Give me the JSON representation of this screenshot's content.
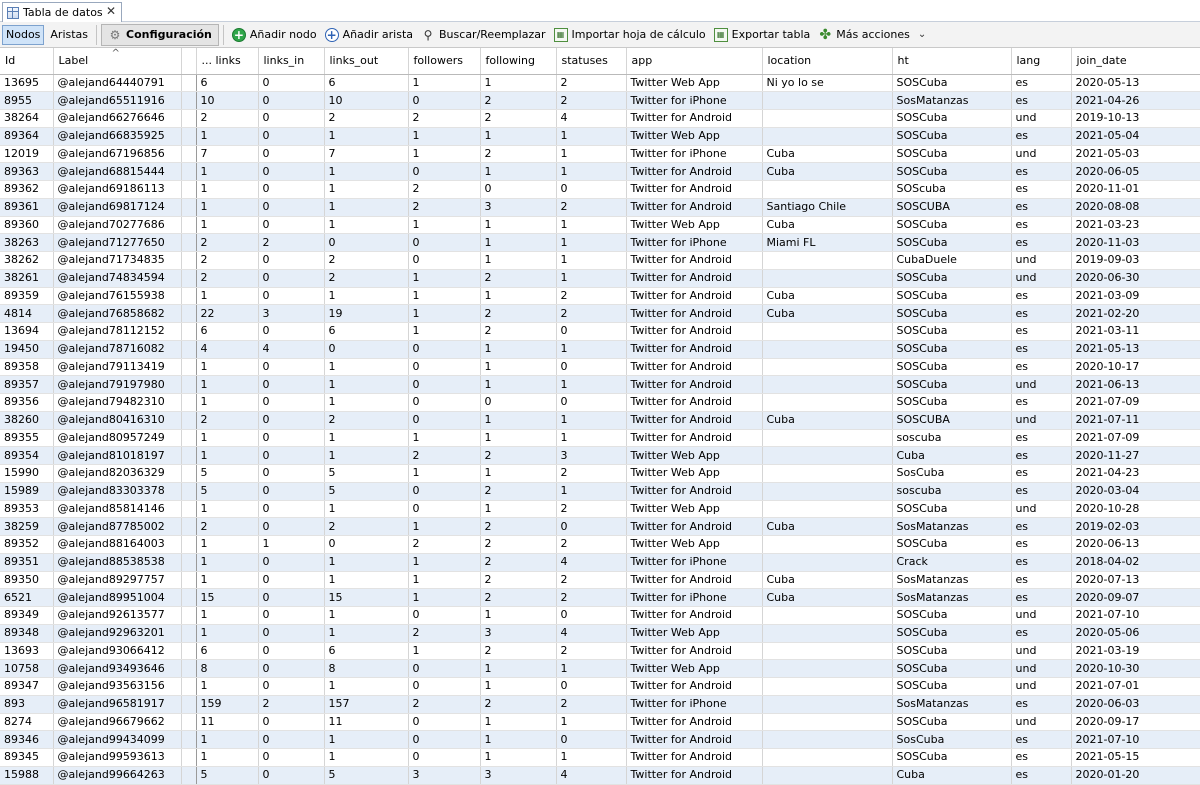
{
  "tab": {
    "title": "Tabla de datos",
    "close": "✕"
  },
  "toolbar": {
    "nodes": "Nodos",
    "edges": "Aristas",
    "config": "Configuración",
    "add_node": "Añadir nodo",
    "add_edge": "Añadir arista",
    "search_replace": "Buscar/Reemplazar",
    "import_sheet": "Importar hoja de cálculo",
    "export_table": "Exportar tabla",
    "more_actions": "Más acciones"
  },
  "table": {
    "columns": [
      "Id",
      "Label",
      "",
      "... links",
      "links_in",
      "links_out",
      "followers",
      "following",
      "statuses",
      "app",
      "location",
      "ht",
      "lang",
      "join_date"
    ],
    "rows": [
      [
        "13695",
        "@alejand64440791",
        "",
        "6",
        "0",
        "6",
        "1",
        "1",
        "2",
        "Twitter Web App",
        "Ni yo lo se",
        "SOSCuba",
        "es",
        "2020-05-13"
      ],
      [
        "8955",
        "@alejand65511916",
        "",
        "10",
        "0",
        "10",
        "0",
        "2",
        "2",
        "Twitter for iPhone",
        "",
        "SosMatanzas",
        "es",
        "2021-04-26"
      ],
      [
        "38264",
        "@alejand66276646",
        "",
        "2",
        "0",
        "2",
        "2",
        "2",
        "4",
        "Twitter for Android",
        "",
        "SOSCuba",
        "und",
        "2019-10-13"
      ],
      [
        "89364",
        "@alejand66835925",
        "",
        "1",
        "0",
        "1",
        "1",
        "1",
        "1",
        "Twitter Web App",
        "",
        "SOSCuba",
        "es",
        "2021-05-04"
      ],
      [
        "12019",
        "@alejand67196856",
        "",
        "7",
        "0",
        "7",
        "1",
        "2",
        "1",
        "Twitter for iPhone",
        "Cuba",
        "SOSCuba",
        "und",
        "2021-05-03"
      ],
      [
        "89363",
        "@alejand68815444",
        "",
        "1",
        "0",
        "1",
        "0",
        "1",
        "1",
        "Twitter for Android",
        "Cuba",
        "SOSCuba",
        "es",
        "2020-06-05"
      ],
      [
        "89362",
        "@alejand69186113",
        "",
        "1",
        "0",
        "1",
        "2",
        "0",
        "0",
        "Twitter for Android",
        "",
        "SOScuba",
        "es",
        "2020-11-01"
      ],
      [
        "89361",
        "@alejand69817124",
        "",
        "1",
        "0",
        "1",
        "2",
        "3",
        "2",
        "Twitter for Android",
        "Santiago  Chile",
        "SOSCUBA",
        "es",
        "2020-08-08"
      ],
      [
        "89360",
        "@alejand70277686",
        "",
        "1",
        "0",
        "1",
        "1",
        "1",
        "1",
        "Twitter Web App",
        "Cuba",
        "SOSCuba",
        "es",
        "2021-03-23"
      ],
      [
        "38263",
        "@alejand71277650",
        "",
        "2",
        "2",
        "0",
        "0",
        "1",
        "1",
        "Twitter for iPhone",
        "Miami  FL",
        "SOSCuba",
        "es",
        "2020-11-03"
      ],
      [
        "38262",
        "@alejand71734835",
        "",
        "2",
        "0",
        "2",
        "0",
        "1",
        "1",
        "Twitter for Android",
        "",
        "CubaDuele",
        "und",
        "2019-09-03"
      ],
      [
        "38261",
        "@alejand74834594",
        "",
        "2",
        "0",
        "2",
        "1",
        "2",
        "1",
        "Twitter for Android",
        "",
        "SOSCuba",
        "und",
        "2020-06-30"
      ],
      [
        "89359",
        "@alejand76155938",
        "",
        "1",
        "0",
        "1",
        "1",
        "1",
        "2",
        "Twitter for Android",
        "Cuba",
        "SOSCuba",
        "es",
        "2021-03-09"
      ],
      [
        "4814",
        "@alejand76858682",
        "",
        "22",
        "3",
        "19",
        "1",
        "2",
        "2",
        "Twitter for Android",
        "Cuba",
        "SOSCuba",
        "es",
        "2021-02-20"
      ],
      [
        "13694",
        "@alejand78112152",
        "",
        "6",
        "0",
        "6",
        "1",
        "2",
        "0",
        "Twitter for Android",
        "",
        "SOSCuba",
        "es",
        "2021-03-11"
      ],
      [
        "19450",
        "@alejand78716082",
        "",
        "4",
        "4",
        "0",
        "0",
        "1",
        "1",
        "Twitter for Android",
        "",
        "SOSCuba",
        "es",
        "2021-05-13"
      ],
      [
        "89358",
        "@alejand79113419",
        "",
        "1",
        "0",
        "1",
        "0",
        "1",
        "0",
        "Twitter for Android",
        "",
        "SOSCuba",
        "es",
        "2020-10-17"
      ],
      [
        "89357",
        "@alejand79197980",
        "",
        "1",
        "0",
        "1",
        "0",
        "1",
        "1",
        "Twitter for Android",
        "",
        "SOSCuba",
        "und",
        "2021-06-13"
      ],
      [
        "89356",
        "@alejand79482310",
        "",
        "1",
        "0",
        "1",
        "0",
        "0",
        "0",
        "Twitter for Android",
        "",
        "SOSCuba",
        "es",
        "2021-07-09"
      ],
      [
        "38260",
        "@alejand80416310",
        "",
        "2",
        "0",
        "2",
        "0",
        "1",
        "1",
        "Twitter for Android",
        "Cuba",
        "SOSCUBA",
        "und",
        "2021-07-11"
      ],
      [
        "89355",
        "@alejand80957249",
        "",
        "1",
        "0",
        "1",
        "1",
        "1",
        "1",
        "Twitter for Android",
        "",
        "soscuba",
        "es",
        "2021-07-09"
      ],
      [
        "89354",
        "@alejand81018197",
        "",
        "1",
        "0",
        "1",
        "2",
        "2",
        "3",
        "Twitter Web App",
        "",
        "Cuba",
        "es",
        "2020-11-27"
      ],
      [
        "15990",
        "@alejand82036329",
        "",
        "5",
        "0",
        "5",
        "1",
        "1",
        "2",
        "Twitter Web App",
        "",
        "SosCuba",
        "es",
        "2021-04-23"
      ],
      [
        "15989",
        "@alejand83303378",
        "",
        "5",
        "0",
        "5",
        "0",
        "2",
        "1",
        "Twitter for Android",
        "",
        "soscuba",
        "es",
        "2020-03-04"
      ],
      [
        "89353",
        "@alejand85814146",
        "",
        "1",
        "0",
        "1",
        "0",
        "1",
        "2",
        "Twitter Web App",
        "",
        "SOSCuba",
        "und",
        "2020-10-28"
      ],
      [
        "38259",
        "@alejand87785002",
        "",
        "2",
        "0",
        "2",
        "1",
        "2",
        "0",
        "Twitter for Android",
        "Cuba",
        "SosMatanzas",
        "es",
        "2019-02-03"
      ],
      [
        "89352",
        "@alejand88164003",
        "",
        "1",
        "1",
        "0",
        "2",
        "2",
        "2",
        "Twitter Web App",
        "",
        "SOSCuba",
        "es",
        "2020-06-13"
      ],
      [
        "89351",
        "@alejand88538538",
        "",
        "1",
        "0",
        "1",
        "1",
        "2",
        "4",
        "Twitter for iPhone",
        "",
        "Crack",
        "es",
        "2018-04-02"
      ],
      [
        "89350",
        "@alejand89297757",
        "",
        "1",
        "0",
        "1",
        "1",
        "2",
        "2",
        "Twitter for Android",
        "Cuba",
        "SosMatanzas",
        "es",
        "2020-07-13"
      ],
      [
        "6521",
        "@alejand89951004",
        "",
        "15",
        "0",
        "15",
        "1",
        "2",
        "2",
        "Twitter for iPhone",
        "Cuba",
        "SosMatanzas",
        "es",
        "2020-09-07"
      ],
      [
        "89349",
        "@alejand92613577",
        "",
        "1",
        "0",
        "1",
        "0",
        "1",
        "0",
        "Twitter for Android",
        "",
        "SOSCuba",
        "und",
        "2021-07-10"
      ],
      [
        "89348",
        "@alejand92963201",
        "",
        "1",
        "0",
        "1",
        "2",
        "3",
        "4",
        "Twitter Web App",
        "",
        "SOSCuba",
        "es",
        "2020-05-06"
      ],
      [
        "13693",
        "@alejand93066412",
        "",
        "6",
        "0",
        "6",
        "1",
        "2",
        "2",
        "Twitter for Android",
        "",
        "SOSCuba",
        "und",
        "2021-03-19"
      ],
      [
        "10758",
        "@alejand93493646",
        "",
        "8",
        "0",
        "8",
        "0",
        "1",
        "1",
        "Twitter Web App",
        "",
        "SOSCuba",
        "und",
        "2020-10-30"
      ],
      [
        "89347",
        "@alejand93563156",
        "",
        "1",
        "0",
        "1",
        "0",
        "1",
        "0",
        "Twitter for Android",
        "",
        "SOSCuba",
        "und",
        "2021-07-01"
      ],
      [
        "893",
        "@alejand96581917",
        "",
        "159",
        "2",
        "157",
        "2",
        "2",
        "2",
        "Twitter for iPhone",
        "",
        "SosMatanzas",
        "es",
        "2020-06-03"
      ],
      [
        "8274",
        "@alejand96679662",
        "",
        "11",
        "0",
        "11",
        "0",
        "1",
        "1",
        "Twitter for Android",
        "",
        "SOSCuba",
        "und",
        "2020-09-17"
      ],
      [
        "89346",
        "@alejand99434099",
        "",
        "1",
        "0",
        "1",
        "0",
        "1",
        "0",
        "Twitter for Android",
        "",
        "SosCuba",
        "es",
        "2021-07-10"
      ],
      [
        "89345",
        "@alejand99593613",
        "",
        "1",
        "0",
        "1",
        "0",
        "1",
        "1",
        "Twitter for Android",
        "",
        "SOSCuba",
        "es",
        "2021-05-15"
      ],
      [
        "15988",
        "@alejand99664263",
        "",
        "5",
        "0",
        "5",
        "3",
        "3",
        "4",
        "Twitter for Android",
        "",
        "Cuba",
        "es",
        "2020-01-20"
      ]
    ]
  }
}
